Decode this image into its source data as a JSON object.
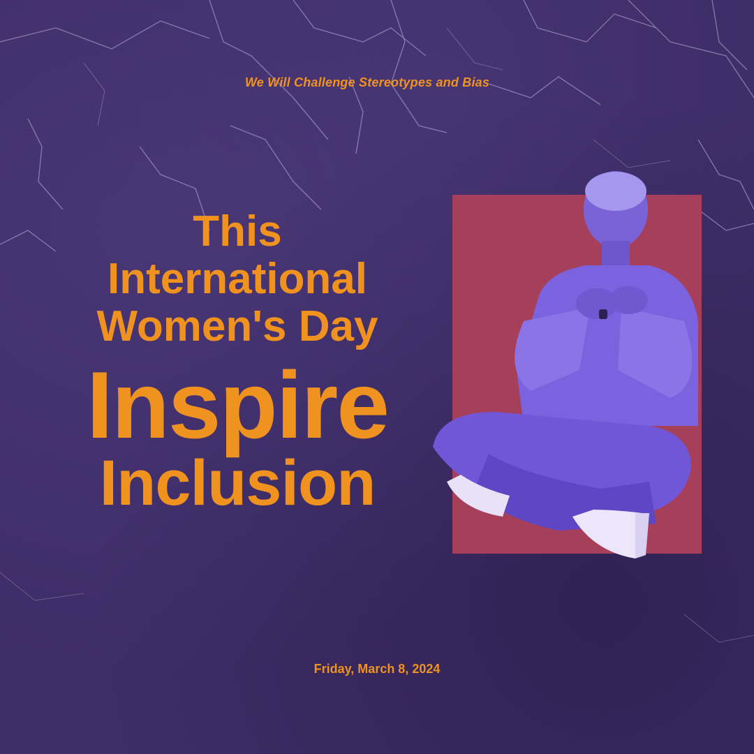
{
  "poster": {
    "tagline": "We Will Challenge Stereotypes and Bias",
    "headline_line1": "This",
    "headline_line2": "International",
    "headline_line3": "Women's Day",
    "headline_line4": "Inspire",
    "headline_line5": "Inclusion",
    "date": "Friday, March 8, 2024"
  },
  "colors": {
    "background": "#3f2d68",
    "accent_text": "#f0921f",
    "photo_backdrop": "#a6405a",
    "figure_tint": "#7a63d6"
  },
  "icons": {
    "photo": "woman-meditating-photo"
  }
}
